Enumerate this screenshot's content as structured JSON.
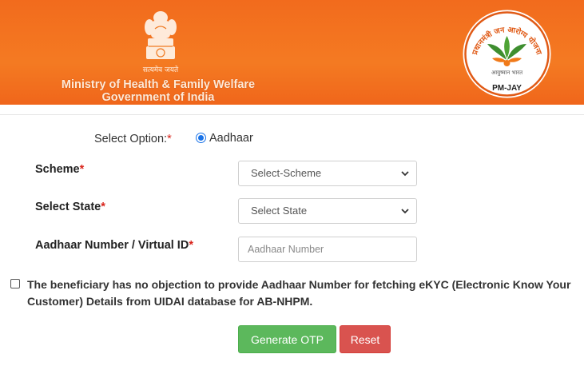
{
  "header": {
    "emblem_caption": "सत्यमेव जयते",
    "ministry_line1": "Ministry of Health & Family Welfare",
    "ministry_line2": "Government of India",
    "logo_arc_text": "प्रधानमंत्री जन आरोग्य योजना",
    "logo_bottom_text": "आयुष्मान भारत",
    "logo_ribbon_text": "PM-JAY",
    "colors": {
      "header_bg": "#f26b1d",
      "logo_green": "#3e8e2f",
      "logo_orange": "#f07a1a"
    }
  },
  "form": {
    "select_option_label": "Select Option:",
    "required_mark": "*",
    "option_aadhaar": "Aadhaar",
    "scheme_label": "Scheme",
    "scheme_value": "Select-Scheme",
    "state_label": "Select State",
    "state_value": "Select State",
    "aadhaar_label": "Aadhaar Number / Virtual ID",
    "aadhaar_placeholder": "Aadhaar Number",
    "consent_text": "The beneficiary has no objection to provide Aadhaar Number for fetching eKYC (Electronic Know Your Customer) Details from UIDAI database for AB-NHPM.",
    "consent_checked": false
  },
  "buttons": {
    "generate_otp": "Generate OTP",
    "reset": "Reset",
    "colors": {
      "primary": "#5cb85c",
      "danger": "#d9534f"
    }
  }
}
